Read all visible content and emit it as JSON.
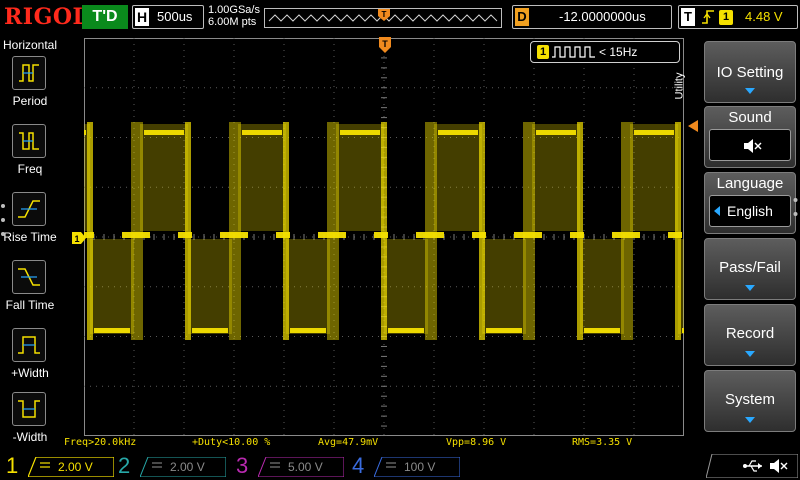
{
  "brand": "RIGOL",
  "status": {
    "run_state": "T'D"
  },
  "horizontal": {
    "letter": "H",
    "timebase": "500us"
  },
  "sampling": {
    "rate": "1.00GSa/s",
    "points": "6.00M pts"
  },
  "trigger_position": {
    "marker": "T"
  },
  "delay": {
    "letter": "D",
    "value": "-12.0000000us"
  },
  "trigger": {
    "letter": "T",
    "edge": "rising",
    "source": "1",
    "level": "4.48 V"
  },
  "left_menu": {
    "title": "Horizontal",
    "items": [
      {
        "label": "Period",
        "icon": "period-icon"
      },
      {
        "label": "Freq",
        "icon": "frequency-icon"
      },
      {
        "label": "Rise Time",
        "icon": "rise-time-icon"
      },
      {
        "label": "Fall Time",
        "icon": "fall-time-icon"
      },
      {
        "label": "+Width",
        "icon": "positive-width-icon"
      },
      {
        "label": "-Width",
        "icon": "negative-width-icon"
      }
    ]
  },
  "freq_counter": {
    "channel": "1",
    "text": "< 15Hz"
  },
  "channel_marker": "1",
  "measurements": {
    "freq": "Freq>20.0kHz",
    "duty": "+Duty<10.00 %",
    "avg": "Avg=47.9mV",
    "vpp": "Vpp=8.96 V",
    "rms": "RMS=3.35 V"
  },
  "channels": [
    {
      "num": "1",
      "scale": "2.00 V",
      "color": "#f5e000",
      "active": true
    },
    {
      "num": "2",
      "scale": "2.00 V",
      "color": "#27a8a8",
      "active": false
    },
    {
      "num": "3",
      "scale": "5.00 V",
      "color": "#b92ab0",
      "active": false
    },
    {
      "num": "4",
      "scale": "100 V",
      "color": "#3a6ce0",
      "active": false
    }
  ],
  "right_menu": {
    "title": "Utility",
    "items": [
      {
        "label": "IO Setting"
      },
      {
        "label": "Sound"
      },
      {
        "label": "Language",
        "value": "English"
      },
      {
        "label": "Pass/Fail"
      },
      {
        "label": "Record"
      },
      {
        "label": "System"
      }
    ]
  },
  "colors": {
    "trace": "#f5e000",
    "trigger": "#f08a1e",
    "run_status": "#0a8a1c",
    "brand": "#ff2a1c",
    "accent": "#29a8ff"
  }
}
